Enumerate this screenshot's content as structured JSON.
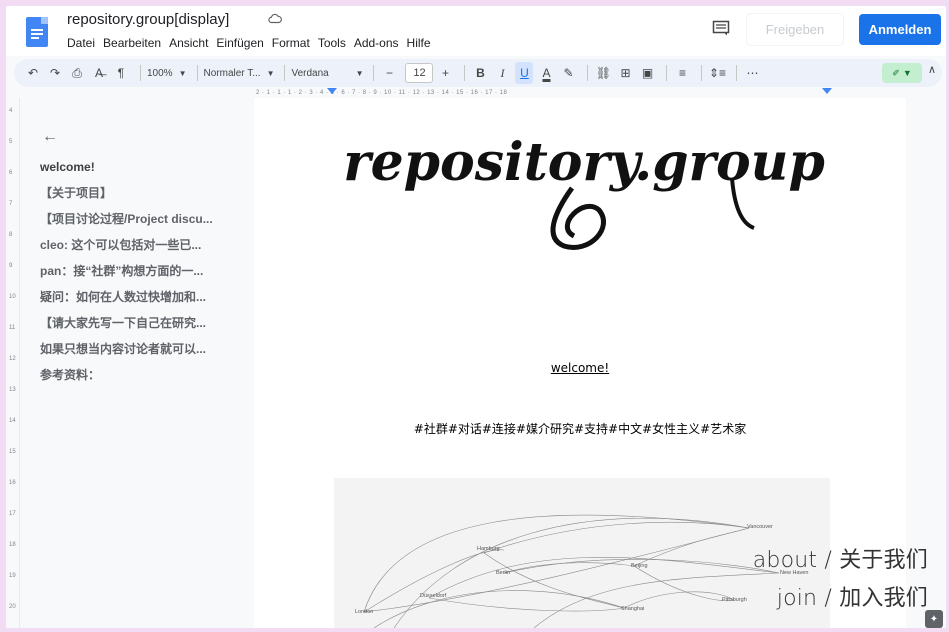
{
  "title": "repository.group[display]",
  "menu": [
    "Datei",
    "Bearbeiten",
    "Ansicht",
    "Einfügen",
    "Format",
    "Tools",
    "Add-ons",
    "Hilfe"
  ],
  "buttons": {
    "share": "Freigeben",
    "signin": "Anmelden"
  },
  "toolbar": {
    "zoom": "100%",
    "style": "Normaler T...",
    "font": "Verdana",
    "size": "12",
    "minus": "−",
    "plus": "+",
    "bold": "B",
    "italic": "I",
    "underline": "U",
    "color": "A",
    "more": "⋯"
  },
  "ruler_text": "2 · 1 · 1 · 1 · 2 · 3 · 4 · 5 · 6 · 7 · 8 · 9 · 10 · 11 · 12 · 13 · 14 · 15 · 16 · 17 · 18",
  "vruler": [
    "4",
    "5",
    "6",
    "7",
    "8",
    "9",
    "10",
    "11",
    "12",
    "13",
    "14",
    "15",
    "16",
    "17",
    "18",
    "19",
    "20"
  ],
  "outline": {
    "back_icon": "←",
    "items": [
      "welcome!",
      "【关于项目】",
      "【项目讨论过程/Project discu...",
      "cleo: 这个可以包括对一些已...",
      "pan：接“社群”构想方面的一...",
      "疑问：如何在人数过快增加和...",
      "【请大家先写一下自己在研究...",
      "如果只想当内容讨论者就可以...",
      "参考资料："
    ]
  },
  "page": {
    "logo_text": "repository.group",
    "welcome": "welcome!",
    "tags": "#社群#对话#连接#媒介研究#支持#中文#女性主义#艺术家"
  },
  "map": {
    "cities": [
      "Vancouver",
      "Hamburg",
      "Berlin",
      "Beijing",
      "New Haven",
      "Düsseldorf",
      "Pittsburgh",
      "Shanghai",
      "London"
    ]
  },
  "overlay": {
    "about": "about / 关于我们",
    "join": "join / 加入我们"
  },
  "colors": {
    "signin": "#1a73e8",
    "docs_blue": "#4285f4",
    "toolbar_bg": "#edf2fa",
    "border_pink": "#f1dcf3"
  }
}
